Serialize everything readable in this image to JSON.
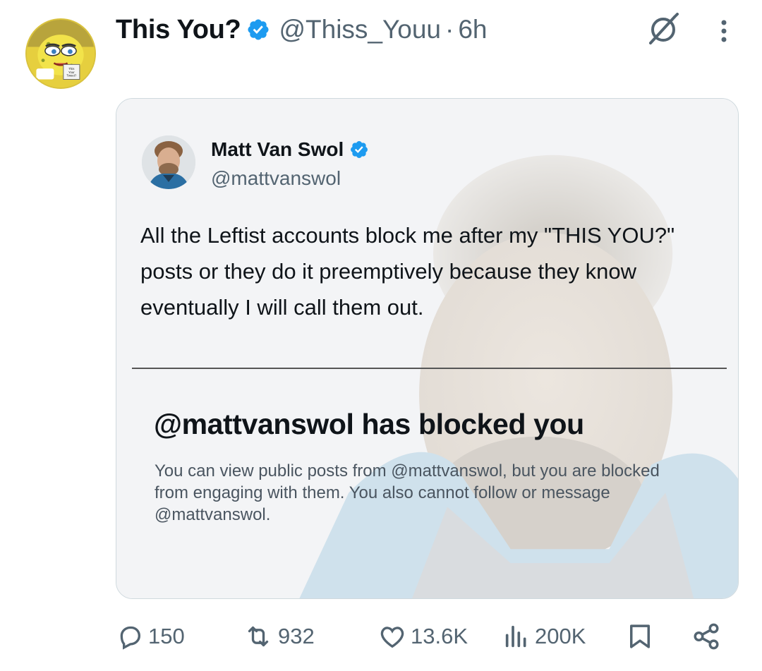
{
  "tweet": {
    "display_name": "This You?",
    "handle": "@Thiss_Youu",
    "separator": "·",
    "time": "6h",
    "avatar_text": [
      "This",
      "Your",
      "Tweet?"
    ]
  },
  "quoted": {
    "name": "Matt Van Swol",
    "handle": "@mattvanswol",
    "text": "All the Leftist accounts block me after my \"THIS YOU?\" posts or they do it preemptively because they know eventually I will call them out.",
    "blocked_title": "@mattvanswol has blocked you",
    "blocked_description": "You can view public posts from @mattvanswol, but you are blocked from engaging with them. You also cannot follow or message @mattvanswol."
  },
  "actions": {
    "replies": "150",
    "reposts": "932",
    "likes": "13.6K",
    "views": "200K"
  },
  "colors": {
    "verified": "#1d9bf0",
    "text": "#0f1419",
    "secondary": "#536471"
  },
  "icons": [
    "verified-icon",
    "grok-icon",
    "more-icon",
    "reply-icon",
    "repost-icon",
    "like-icon",
    "views-icon",
    "bookmark-icon",
    "share-icon"
  ]
}
